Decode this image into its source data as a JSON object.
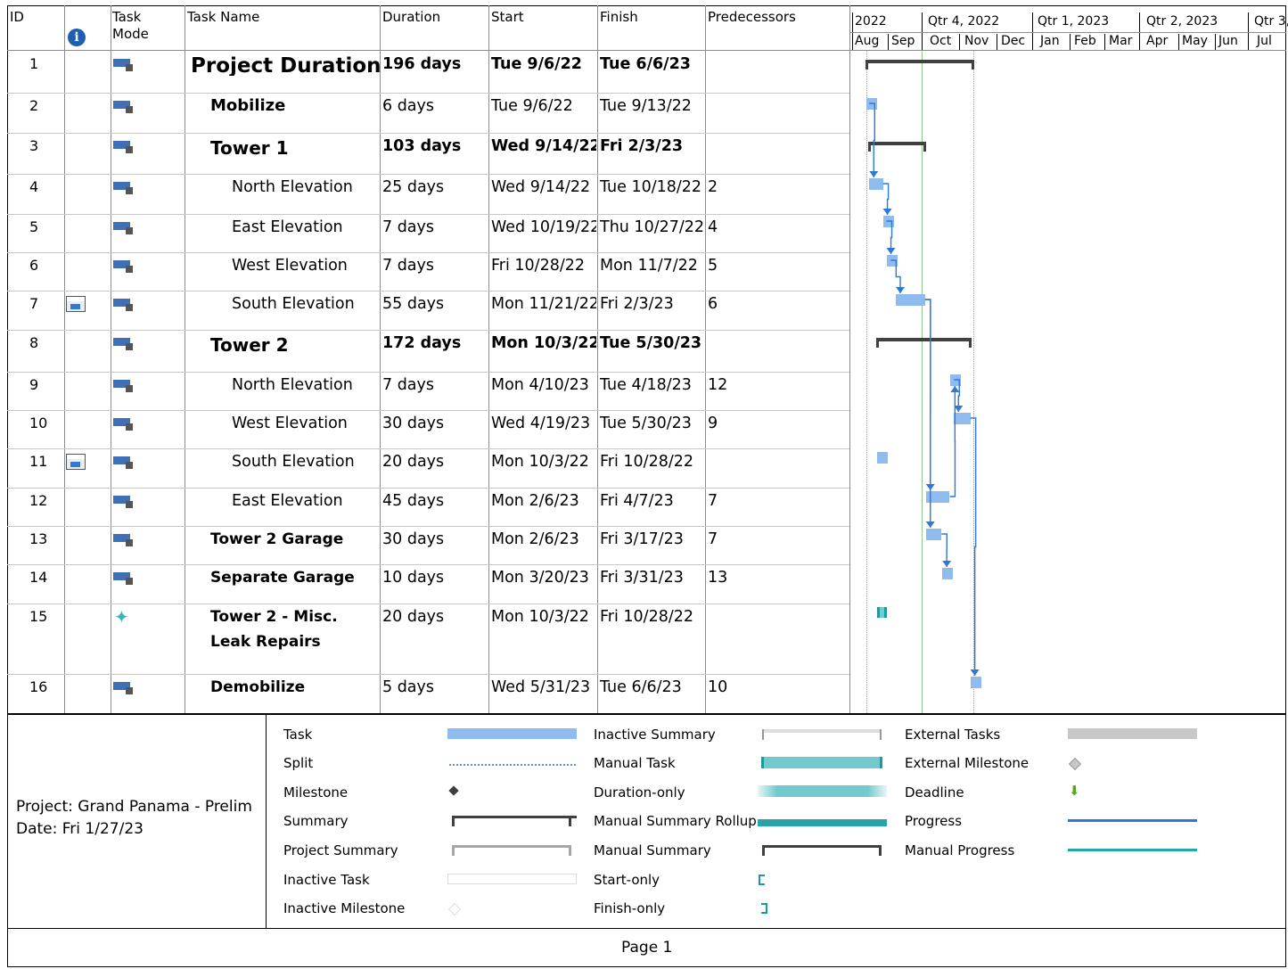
{
  "columns": {
    "id": "ID",
    "info": "i",
    "task_mode": "Task\nMode",
    "task_name": "Task Name",
    "duration": "Duration",
    "start": "Start",
    "finish": "Finish",
    "predecessors": "Predecessors"
  },
  "timescale": {
    "top": [
      "2022",
      "Qtr 4, 2022",
      "Qtr 1, 2023",
      "Qtr 2, 2023",
      "Qtr 3,"
    ],
    "bottom": [
      "Aug",
      "Sep",
      "Oct",
      "Nov",
      "Dec",
      "Jan",
      "Feb",
      "Mar",
      "Apr",
      "May",
      "Jun",
      "Jul"
    ]
  },
  "tasks": [
    {
      "id": "1",
      "name": "Project Duration",
      "duration": "196 days",
      "start": "Tue 9/6/22",
      "finish": "Tue 6/6/23",
      "pred": "",
      "level": "project",
      "calendar": false,
      "mode": "auto"
    },
    {
      "id": "2",
      "name": "Mobilize",
      "duration": "6 days",
      "start": "Tue 9/6/22",
      "finish": "Tue 9/13/22",
      "pred": "",
      "level": "l1",
      "calendar": false,
      "mode": "auto"
    },
    {
      "id": "3",
      "name": "Tower 1",
      "duration": "103 days",
      "start": "Wed 9/14/22",
      "finish": "Fri 2/3/23",
      "pred": "",
      "level": "summary",
      "calendar": false,
      "mode": "auto"
    },
    {
      "id": "4",
      "name": "North Elevation",
      "duration": "25 days",
      "start": "Wed 9/14/22",
      "finish": "Tue 10/18/22",
      "pred": "2",
      "level": "l2",
      "calendar": false,
      "mode": "auto"
    },
    {
      "id": "5",
      "name": "East Elevation",
      "duration": "7 days",
      "start": "Wed 10/19/22",
      "finish": "Thu 10/27/22",
      "pred": "4",
      "level": "l2",
      "calendar": false,
      "mode": "auto"
    },
    {
      "id": "6",
      "name": "West Elevation",
      "duration": "7 days",
      "start": "Fri 10/28/22",
      "finish": "Mon 11/7/22",
      "pred": "5",
      "level": "l2",
      "calendar": false,
      "mode": "auto"
    },
    {
      "id": "7",
      "name": "South Elevation",
      "duration": "55 days",
      "start": "Mon 11/21/22",
      "finish": "Fri 2/3/23",
      "pred": "6",
      "level": "l2",
      "calendar": true,
      "mode": "auto"
    },
    {
      "id": "8",
      "name": "Tower 2",
      "duration": "172 days",
      "start": "Mon 10/3/22",
      "finish": "Tue 5/30/23",
      "pred": "",
      "level": "summary",
      "calendar": false,
      "mode": "auto"
    },
    {
      "id": "9",
      "name": "North Elevation",
      "duration": "7 days",
      "start": "Mon 4/10/23",
      "finish": "Tue 4/18/23",
      "pred": "12",
      "level": "l2",
      "calendar": false,
      "mode": "auto"
    },
    {
      "id": "10",
      "name": "West Elevation",
      "duration": "30 days",
      "start": "Wed 4/19/23",
      "finish": "Tue 5/30/23",
      "pred": "9",
      "level": "l2",
      "calendar": false,
      "mode": "auto"
    },
    {
      "id": "11",
      "name": "South Elevation",
      "duration": "20 days",
      "start": "Mon 10/3/22",
      "finish": "Fri 10/28/22",
      "pred": "",
      "level": "l2",
      "calendar": true,
      "mode": "auto"
    },
    {
      "id": "12",
      "name": "East Elevation",
      "duration": "45 days",
      "start": "Mon 2/6/23",
      "finish": "Fri 4/7/23",
      "pred": "7",
      "level": "l2",
      "calendar": false,
      "mode": "auto"
    },
    {
      "id": "13",
      "name": "Tower 2 Garage",
      "duration": "30 days",
      "start": "Mon 2/6/23",
      "finish": "Fri 3/17/23",
      "pred": "7",
      "level": "l1b",
      "calendar": false,
      "mode": "auto"
    },
    {
      "id": "14",
      "name": "Separate Garage",
      "duration": "10 days",
      "start": "Mon 3/20/23",
      "finish": "Fri 3/31/23",
      "pred": "13",
      "level": "l1b",
      "calendar": false,
      "mode": "auto"
    },
    {
      "id": "15",
      "name": "Tower 2 -  Misc. Leak Repairs",
      "duration": "20 days",
      "start": "Mon 10/3/22",
      "finish": "Fri 10/28/22",
      "pred": "",
      "level": "l1b",
      "calendar": false,
      "mode": "manual"
    },
    {
      "id": "16",
      "name": "Demobilize",
      "duration": "5 days",
      "start": "Wed 5/31/23",
      "finish": "Tue 6/6/23",
      "pred": "10",
      "level": "l1b",
      "calendar": false,
      "mode": "auto"
    }
  ],
  "footer": {
    "project": "Project: Grand Panama - Prelim",
    "date": "Date: Fri 1/27/23",
    "page": "Page 1"
  },
  "legend": {
    "col1": [
      "Task",
      "Split",
      "Milestone",
      "Summary",
      "Project Summary",
      "Inactive Task",
      "Inactive Milestone"
    ],
    "col2": [
      "Inactive Summary",
      "Manual Task",
      "Duration-only",
      "Manual Summary Rollup",
      "Manual Summary",
      "Start-only",
      "Finish-only"
    ],
    "col3": [
      "External Tasks",
      "External Milestone",
      "Deadline",
      "Progress",
      "Manual Progress"
    ]
  },
  "colors": {
    "task": "#8fbbef",
    "manual": "#72cacf",
    "summary": "#404040",
    "link": "#2e78d6",
    "today": "#8fc78f"
  }
}
